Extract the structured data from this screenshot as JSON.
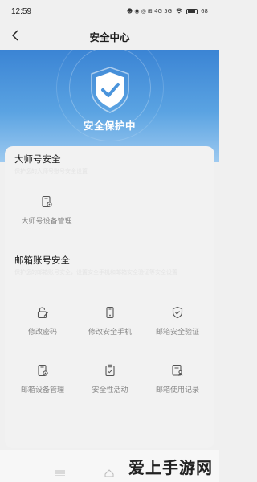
{
  "status_bar": {
    "time": "12:59",
    "indicators": "☻ ◉ ◎ ⊞ 4G 5G",
    "battery": "68"
  },
  "header": {
    "title": "安全中心"
  },
  "hero": {
    "title": "安全保护中"
  },
  "master_section": {
    "title": "大师号安全",
    "description": "保护您的大师号账号安全设置",
    "items": [
      {
        "label": "大师号设备管理",
        "icon": "phone-gear-icon"
      }
    ]
  },
  "mail_section": {
    "title": "邮箱账号安全",
    "description": "保护您的邮箱账号安全，设置安全手机和邮箱安全验证等安全设置",
    "items": [
      {
        "label": "修改密码",
        "icon": "lock-edit-icon"
      },
      {
        "label": "修改安全手机",
        "icon": "phone-icon"
      },
      {
        "label": "邮箱安全验证",
        "icon": "shield-check-icon"
      },
      {
        "label": "邮箱设备管理",
        "icon": "phone-gear-icon"
      },
      {
        "label": "安全性活动",
        "icon": "clipboard-icon"
      },
      {
        "label": "邮箱使用记录",
        "icon": "log-user-icon"
      }
    ]
  },
  "watermark": {
    "text": "爱上手游网"
  },
  "colors": {
    "hero_top": "#3b84d4",
    "hero_bottom": "#9ecaf0",
    "label_gray": "#888888"
  }
}
